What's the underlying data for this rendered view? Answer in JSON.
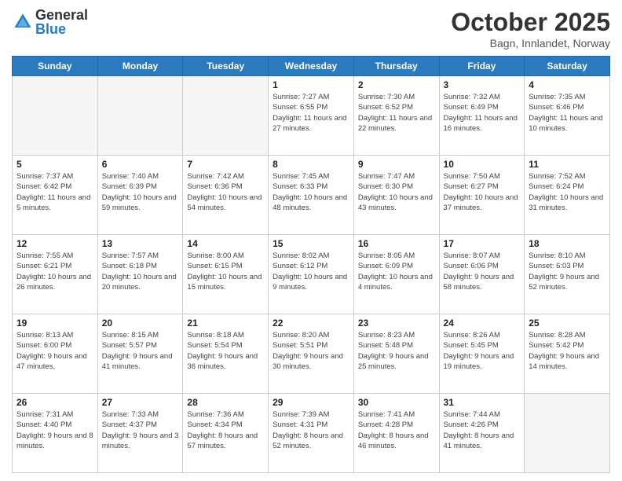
{
  "header": {
    "logo_general": "General",
    "logo_blue": "Blue",
    "month_title": "October 2025",
    "location": "Bagn, Innlandet, Norway"
  },
  "weekdays": [
    "Sunday",
    "Monday",
    "Tuesday",
    "Wednesday",
    "Thursday",
    "Friday",
    "Saturday"
  ],
  "weeks": [
    [
      {
        "day": "",
        "sunrise": "",
        "sunset": "",
        "daylight": ""
      },
      {
        "day": "",
        "sunrise": "",
        "sunset": "",
        "daylight": ""
      },
      {
        "day": "",
        "sunrise": "",
        "sunset": "",
        "daylight": ""
      },
      {
        "day": "1",
        "sunrise": "Sunrise: 7:27 AM",
        "sunset": "Sunset: 6:55 PM",
        "daylight": "Daylight: 11 hours and 27 minutes."
      },
      {
        "day": "2",
        "sunrise": "Sunrise: 7:30 AM",
        "sunset": "Sunset: 6:52 PM",
        "daylight": "Daylight: 11 hours and 22 minutes."
      },
      {
        "day": "3",
        "sunrise": "Sunrise: 7:32 AM",
        "sunset": "Sunset: 6:49 PM",
        "daylight": "Daylight: 11 hours and 16 minutes."
      },
      {
        "day": "4",
        "sunrise": "Sunrise: 7:35 AM",
        "sunset": "Sunset: 6:46 PM",
        "daylight": "Daylight: 11 hours and 10 minutes."
      }
    ],
    [
      {
        "day": "5",
        "sunrise": "Sunrise: 7:37 AM",
        "sunset": "Sunset: 6:42 PM",
        "daylight": "Daylight: 11 hours and 5 minutes."
      },
      {
        "day": "6",
        "sunrise": "Sunrise: 7:40 AM",
        "sunset": "Sunset: 6:39 PM",
        "daylight": "Daylight: 10 hours and 59 minutes."
      },
      {
        "day": "7",
        "sunrise": "Sunrise: 7:42 AM",
        "sunset": "Sunset: 6:36 PM",
        "daylight": "Daylight: 10 hours and 54 minutes."
      },
      {
        "day": "8",
        "sunrise": "Sunrise: 7:45 AM",
        "sunset": "Sunset: 6:33 PM",
        "daylight": "Daylight: 10 hours and 48 minutes."
      },
      {
        "day": "9",
        "sunrise": "Sunrise: 7:47 AM",
        "sunset": "Sunset: 6:30 PM",
        "daylight": "Daylight: 10 hours and 43 minutes."
      },
      {
        "day": "10",
        "sunrise": "Sunrise: 7:50 AM",
        "sunset": "Sunset: 6:27 PM",
        "daylight": "Daylight: 10 hours and 37 minutes."
      },
      {
        "day": "11",
        "sunrise": "Sunrise: 7:52 AM",
        "sunset": "Sunset: 6:24 PM",
        "daylight": "Daylight: 10 hours and 31 minutes."
      }
    ],
    [
      {
        "day": "12",
        "sunrise": "Sunrise: 7:55 AM",
        "sunset": "Sunset: 6:21 PM",
        "daylight": "Daylight: 10 hours and 26 minutes."
      },
      {
        "day": "13",
        "sunrise": "Sunrise: 7:57 AM",
        "sunset": "Sunset: 6:18 PM",
        "daylight": "Daylight: 10 hours and 20 minutes."
      },
      {
        "day": "14",
        "sunrise": "Sunrise: 8:00 AM",
        "sunset": "Sunset: 6:15 PM",
        "daylight": "Daylight: 10 hours and 15 minutes."
      },
      {
        "day": "15",
        "sunrise": "Sunrise: 8:02 AM",
        "sunset": "Sunset: 6:12 PM",
        "daylight": "Daylight: 10 hours and 9 minutes."
      },
      {
        "day": "16",
        "sunrise": "Sunrise: 8:05 AM",
        "sunset": "Sunset: 6:09 PM",
        "daylight": "Daylight: 10 hours and 4 minutes."
      },
      {
        "day": "17",
        "sunrise": "Sunrise: 8:07 AM",
        "sunset": "Sunset: 6:06 PM",
        "daylight": "Daylight: 9 hours and 58 minutes."
      },
      {
        "day": "18",
        "sunrise": "Sunrise: 8:10 AM",
        "sunset": "Sunset: 6:03 PM",
        "daylight": "Daylight: 9 hours and 52 minutes."
      }
    ],
    [
      {
        "day": "19",
        "sunrise": "Sunrise: 8:13 AM",
        "sunset": "Sunset: 6:00 PM",
        "daylight": "Daylight: 9 hours and 47 minutes."
      },
      {
        "day": "20",
        "sunrise": "Sunrise: 8:15 AM",
        "sunset": "Sunset: 5:57 PM",
        "daylight": "Daylight: 9 hours and 41 minutes."
      },
      {
        "day": "21",
        "sunrise": "Sunrise: 8:18 AM",
        "sunset": "Sunset: 5:54 PM",
        "daylight": "Daylight: 9 hours and 36 minutes."
      },
      {
        "day": "22",
        "sunrise": "Sunrise: 8:20 AM",
        "sunset": "Sunset: 5:51 PM",
        "daylight": "Daylight: 9 hours and 30 minutes."
      },
      {
        "day": "23",
        "sunrise": "Sunrise: 8:23 AM",
        "sunset": "Sunset: 5:48 PM",
        "daylight": "Daylight: 9 hours and 25 minutes."
      },
      {
        "day": "24",
        "sunrise": "Sunrise: 8:26 AM",
        "sunset": "Sunset: 5:45 PM",
        "daylight": "Daylight: 9 hours and 19 minutes."
      },
      {
        "day": "25",
        "sunrise": "Sunrise: 8:28 AM",
        "sunset": "Sunset: 5:42 PM",
        "daylight": "Daylight: 9 hours and 14 minutes."
      }
    ],
    [
      {
        "day": "26",
        "sunrise": "Sunrise: 7:31 AM",
        "sunset": "Sunset: 4:40 PM",
        "daylight": "Daylight: 9 hours and 8 minutes."
      },
      {
        "day": "27",
        "sunrise": "Sunrise: 7:33 AM",
        "sunset": "Sunset: 4:37 PM",
        "daylight": "Daylight: 9 hours and 3 minutes."
      },
      {
        "day": "28",
        "sunrise": "Sunrise: 7:36 AM",
        "sunset": "Sunset: 4:34 PM",
        "daylight": "Daylight: 8 hours and 57 minutes."
      },
      {
        "day": "29",
        "sunrise": "Sunrise: 7:39 AM",
        "sunset": "Sunset: 4:31 PM",
        "daylight": "Daylight: 8 hours and 52 minutes."
      },
      {
        "day": "30",
        "sunrise": "Sunrise: 7:41 AM",
        "sunset": "Sunset: 4:28 PM",
        "daylight": "Daylight: 8 hours and 46 minutes."
      },
      {
        "day": "31",
        "sunrise": "Sunrise: 7:44 AM",
        "sunset": "Sunset: 4:26 PM",
        "daylight": "Daylight: 8 hours and 41 minutes."
      },
      {
        "day": "",
        "sunrise": "",
        "sunset": "",
        "daylight": ""
      }
    ]
  ]
}
